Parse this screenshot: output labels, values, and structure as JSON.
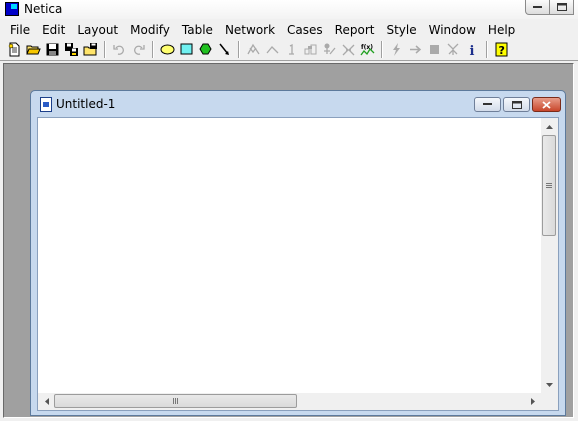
{
  "app": {
    "title": "Netica"
  },
  "menu": [
    "File",
    "Edit",
    "Layout",
    "Modify",
    "Table",
    "Network",
    "Cases",
    "Report",
    "Style",
    "Window",
    "Help"
  ],
  "toolbar": {
    "buttons": [
      "new-icon",
      "open-icon",
      "save-icon",
      "save-as-icon",
      "open-folder-icon",
      "undo-icon",
      "redo-icon",
      "nature-node-icon",
      "decision-node-icon",
      "utility-node-icon",
      "arrow-tool-icon",
      "compile-icon",
      "uncompile-icon",
      "enter-finding-icon",
      "absorb-icon",
      "remove-finding-icon",
      "sensitivity-icon",
      "equation-icon",
      "most-probable-icon",
      "lightning-icon",
      "arrow-right-icon",
      "black-square-icon",
      "junction-icon",
      "info-icon",
      "help-icon"
    ]
  },
  "document": {
    "title": "Untitled-1"
  },
  "colors": {
    "mdi_bg": "#a0a0a0",
    "child_frame": "#c7d9ee",
    "close_red": "#c8462b"
  }
}
